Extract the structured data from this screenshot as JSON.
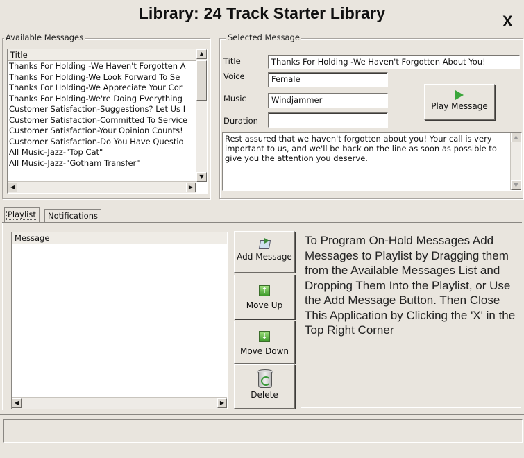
{
  "window": {
    "title": "Library: 24 Track Starter Library",
    "close_label": "X"
  },
  "available": {
    "legend": "Available Messages",
    "column_title": "Title",
    "items": [
      "Thanks For Holding -We Haven't Forgotten A",
      "Thanks For Holding-We Look Forward To Se",
      "Thanks For Holding-We Appreciate Your Cor",
      "Thanks For Holding-We're Doing Everything",
      "Customer Satisfaction-Suggestions?  Let Us I",
      "Customer Satisfaction-Committed To Service",
      "Customer Satisfaction-Your Opinion Counts!",
      "Customer Satisfaction-Do You Have Questio",
      "All Music-Jazz-\"Top Cat\"",
      "All Music-Jazz-\"Gotham Transfer\""
    ]
  },
  "selected": {
    "legend": "Selected Message",
    "title_label": "Title",
    "title_value": "Thanks For Holding -We Haven't Forgotten About You!",
    "voice_label": "Voice",
    "voice_value": "Female",
    "music_label": "Music",
    "music_value": "Windjammer",
    "duration_label": "Duration",
    "duration_value": "",
    "play_button_label": "Play Message",
    "description": "Rest assured that we haven't forgotten about you!  Your call is very important to us, and we'll be back on the line as soon as possible to give you the attention you deserve."
  },
  "tabs": [
    {
      "label": "Playlist",
      "active": true
    },
    {
      "label": "Notifications",
      "active": false
    }
  ],
  "playlist": {
    "column_message": "Message",
    "add_label": "Add Message",
    "move_up_label": "Move Up",
    "move_down_label": "Move Down",
    "delete_label": "Delete",
    "instructions": "To Program On-Hold Messages Add Messages to Playlist by Dragging them from the Available Messages List and Dropping Them Into the Playlist, or Use the Add Message Button.  Then Close This Application by Clicking the 'X' in the Top Right Corner"
  },
  "icons": [
    "play-icon",
    "add-message-icon",
    "arrow-up-icon",
    "arrow-down-icon",
    "recycle-bin-icon"
  ],
  "colors": {
    "play_green": "#3aa63a",
    "arrow_green": "#3d9a2a"
  }
}
